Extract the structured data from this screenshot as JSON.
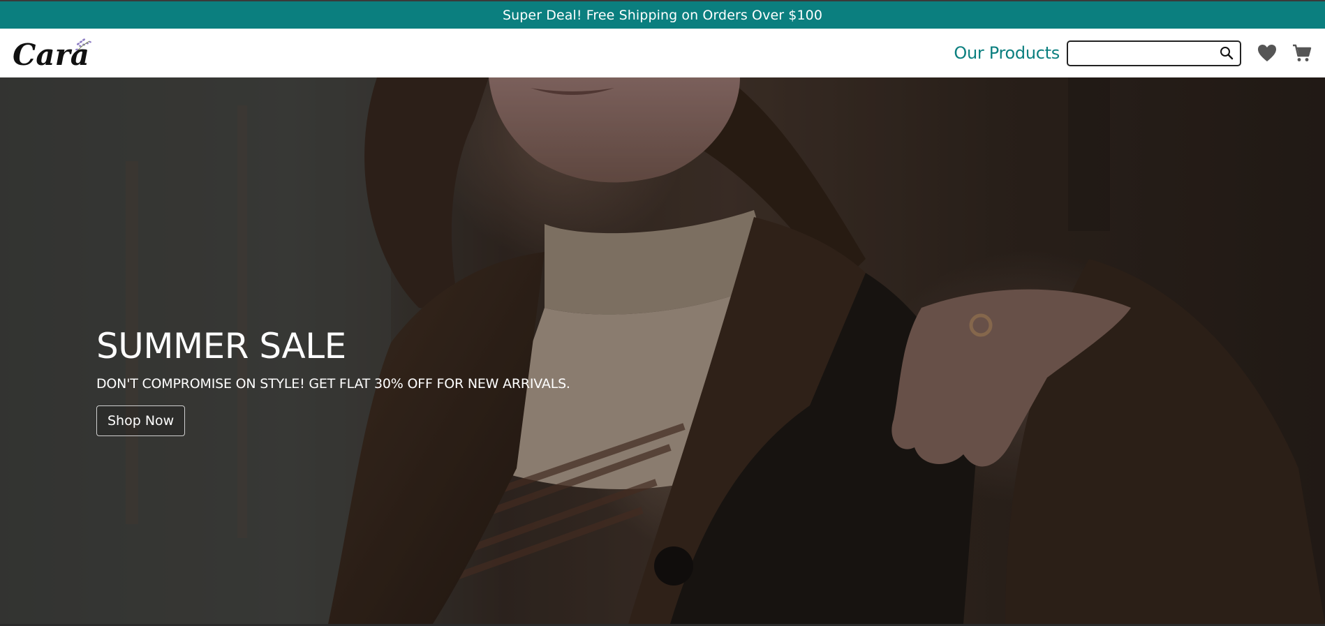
{
  "promo": {
    "text": "Super Deal! Free Shipping on Orders Over $100"
  },
  "brand": {
    "name": "Cara"
  },
  "nav": {
    "products_link": "Our Products",
    "search_placeholder": "",
    "search_value": ""
  },
  "hero": {
    "title": "SUMMER SALE",
    "subtitle": "DON'T COMPROMISE ON STYLE! GET FLAT 30% OFF FOR NEW ARRIVALS.",
    "button": "Shop Now"
  },
  "icons": [
    "search-icon",
    "heart-icon",
    "cart-icon"
  ],
  "colors": {
    "accent": "#0b7f7f",
    "white": "#ffffff",
    "text_dark": "#222222"
  }
}
